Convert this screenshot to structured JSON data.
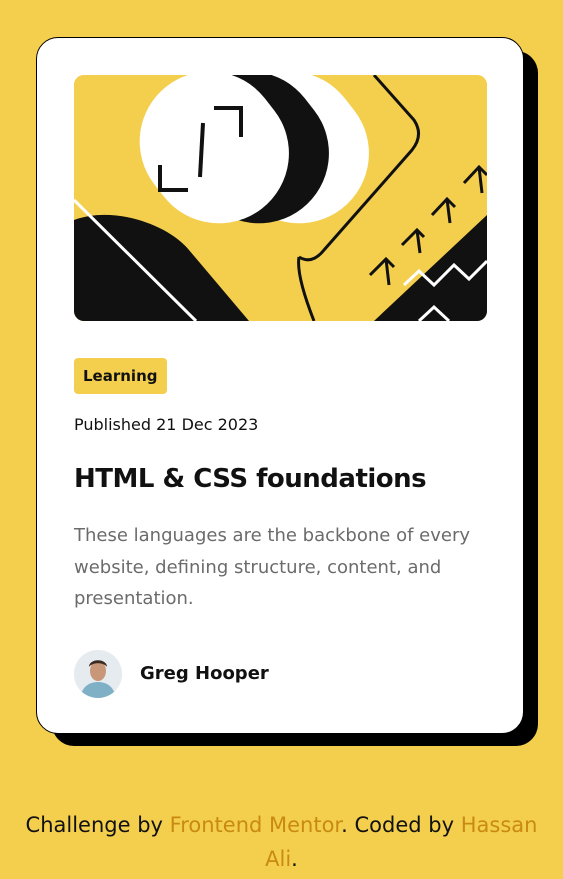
{
  "colors": {
    "background": "#f4cf4e",
    "card": "#ffffff",
    "shadow": "#000000",
    "tag_background": "#f4cf4e",
    "link": "#c98a12",
    "description_text": "#6b6b6b"
  },
  "card": {
    "hero_image": "abstract-illustration",
    "tag": "Learning",
    "published": "Published 21 Dec 2023",
    "title": "HTML & CSS foundations",
    "description": "These languages are the backbone of every website, defining structure, content, and presentation.",
    "author": {
      "avatar": "person-avatar",
      "name": "Greg Hooper"
    }
  },
  "attribution": {
    "prefix": "Challenge by ",
    "link1_text": "Frontend Mentor",
    "middle": ". Coded by ",
    "link2_text": "Hassan Ali",
    "suffix": "."
  }
}
